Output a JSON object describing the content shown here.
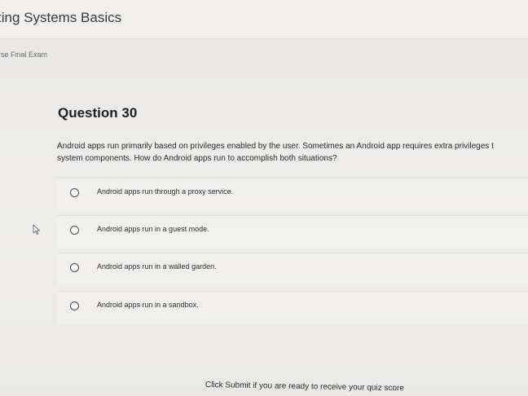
{
  "header": {
    "course_title": "ting Systems Basics",
    "sub_title": "rse Final Exam"
  },
  "question": {
    "title": "Question 30",
    "text_line1": "Android apps run primarily based on privileges enabled by the user. Sometimes an Android app requires extra privileges t",
    "text_line2": "system components. How do Android apps run to accomplish both situations?",
    "options": [
      {
        "label": "Android apps run through a proxy service."
      },
      {
        "label": "Android apps run in a guest mode."
      },
      {
        "label": "Android apps run in a walled garden."
      },
      {
        "label": "Android apps run in a sandbox."
      }
    ]
  },
  "footer": {
    "text": "Click Submit if you are ready to receive your quiz score"
  },
  "icons": {
    "radio": "radio-unselected-icon",
    "cursor": "mouse-pointer-icon"
  }
}
